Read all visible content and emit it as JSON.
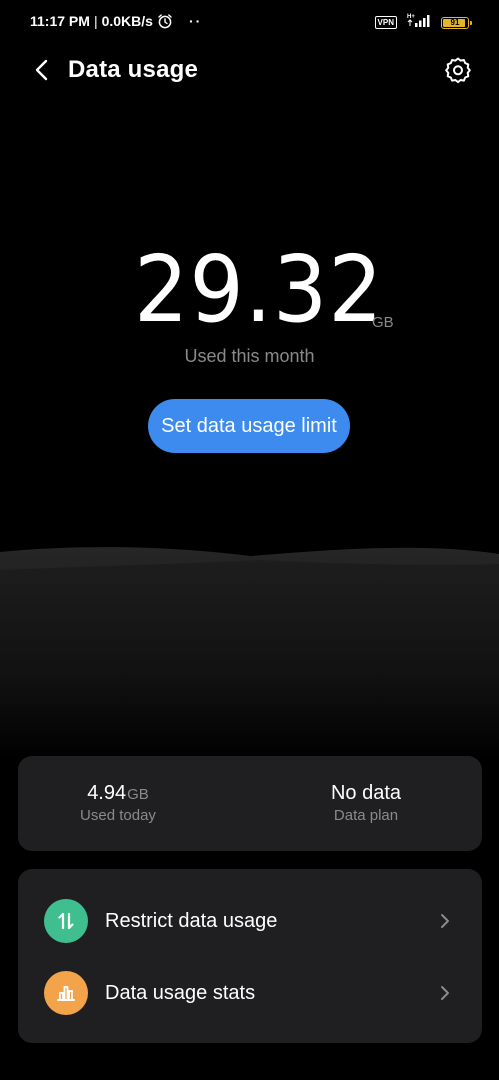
{
  "status_bar": {
    "time": "11:17 PM",
    "separator": "|",
    "net_speed": "0.0KB/s",
    "extra_indicator": "··",
    "vpn_label": "VPN",
    "network_type": "H+",
    "battery_level": "91",
    "battery_fraction": 0.91,
    "battery_color": "#e3b52a",
    "icons": [
      "alarm-icon",
      "signal-icon",
      "battery-icon"
    ]
  },
  "header": {
    "title": "Data usage",
    "back_icon": "back-arrow-icon",
    "settings_icon": "gear-icon"
  },
  "usage": {
    "amount": "29.32",
    "unit": "GB",
    "caption": "Used this month"
  },
  "limit_button": {
    "label": "Set data usage limit",
    "color": "#3e8bf0"
  },
  "summary": {
    "today_value": "4.94",
    "today_unit": "GB",
    "today_label": "Used today",
    "plan_value": "No data",
    "plan_label": "Data plan"
  },
  "actions": [
    {
      "label": "Restrict data usage",
      "icon": "restrict-arrows-icon",
      "color": "#3fbf8f"
    },
    {
      "label": "Data usage stats",
      "icon": "bar-chart-icon",
      "color": "#f3a34a"
    }
  ]
}
